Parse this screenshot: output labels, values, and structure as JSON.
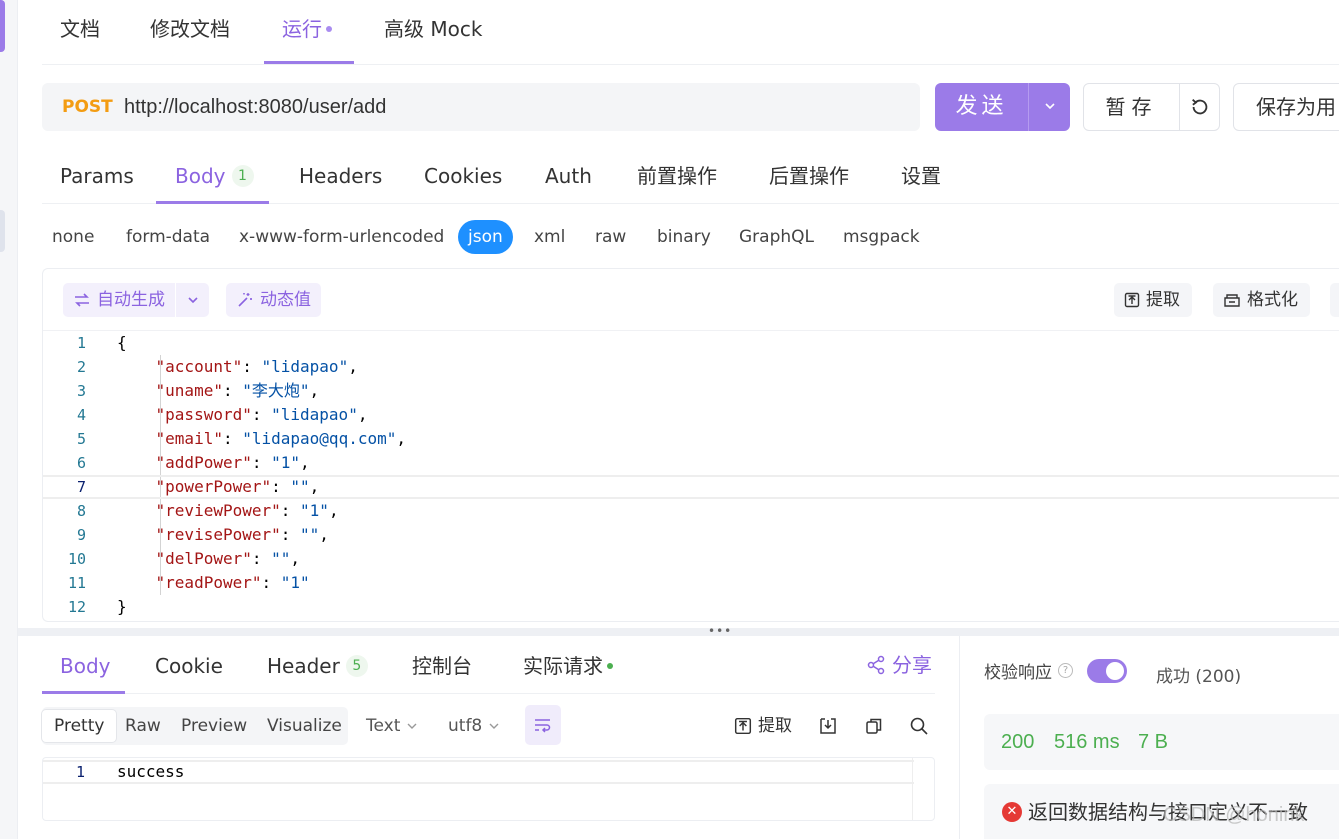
{
  "top_tabs": [
    {
      "label": "文档"
    },
    {
      "label": "修改文档"
    },
    {
      "label": "运行"
    },
    {
      "label": "高级 Mock"
    }
  ],
  "request": {
    "method": "POST",
    "url": "http://localhost:8080/user/add",
    "send_label": "发送",
    "save_temp_label": "暂存",
    "save_as_label": "保存为用"
  },
  "request_tabs": [
    {
      "label": "Params"
    },
    {
      "label": "Body",
      "badge": "1"
    },
    {
      "label": "Headers"
    },
    {
      "label": "Cookies"
    },
    {
      "label": "Auth"
    },
    {
      "label": "前置操作"
    },
    {
      "label": "后置操作"
    },
    {
      "label": "设置"
    }
  ],
  "body_types": [
    "none",
    "form-data",
    "x-www-form-urlencoded",
    "json",
    "xml",
    "raw",
    "binary",
    "GraphQL",
    "msgpack"
  ],
  "editor_toolbar": {
    "auto_gen": "自动生成",
    "dynamic": "动态值",
    "extract": "提取",
    "format": "格式化"
  },
  "code": {
    "l1": "{",
    "rows": [
      {
        "n": "2",
        "key": "\"account\"",
        "val": "\"lidapao\"",
        "end": ","
      },
      {
        "n": "3",
        "key": "\"uname\"",
        "val": "\"李大炮\"",
        "end": ","
      },
      {
        "n": "4",
        "key": "\"password\"",
        "val": "\"lidapao\"",
        "end": ","
      },
      {
        "n": "5",
        "key": "\"email\"",
        "val": "\"lidapao@qq.com\"",
        "end": ","
      },
      {
        "n": "6",
        "key": "\"addPower\"",
        "val": "\"1\"",
        "end": ","
      },
      {
        "n": "7",
        "key": "\"powerPower\"",
        "val": "\"\"",
        "end": ","
      },
      {
        "n": "8",
        "key": "\"reviewPower\"",
        "val": "\"1\"",
        "end": ","
      },
      {
        "n": "9",
        "key": "\"revisePower\"",
        "val": "\"\"",
        "end": ","
      },
      {
        "n": "10",
        "key": "\"delPower\"",
        "val": "\"\"",
        "end": ","
      },
      {
        "n": "11",
        "key": "\"readPower\"",
        "val": "\"1\"",
        "end": ""
      }
    ],
    "l12": "}"
  },
  "response_tabs": [
    {
      "label": "Body"
    },
    {
      "label": "Cookie"
    },
    {
      "label": "Header",
      "badge": "5"
    },
    {
      "label": "控制台"
    },
    {
      "label": "实际请求"
    }
  ],
  "share_label": "分享",
  "view_modes": [
    "Pretty",
    "Raw",
    "Preview",
    "Visualize"
  ],
  "format_select": "Text",
  "encoding_select": "utf8",
  "resp_tools": {
    "extract": "提取"
  },
  "response_body": {
    "n": "1",
    "text": "success"
  },
  "verify": {
    "label": "校验响应",
    "result": "成功 (200)",
    "status_code": "200",
    "time": "516 ms",
    "size": "7 B",
    "error": "返回数据结构与接口定义不一致"
  },
  "watermark": "CSDN @honink",
  "colors": {
    "accent": "#9b7be8",
    "method": "#f39c12",
    "json_active": "#1e90ff",
    "success": "#4caf50"
  }
}
